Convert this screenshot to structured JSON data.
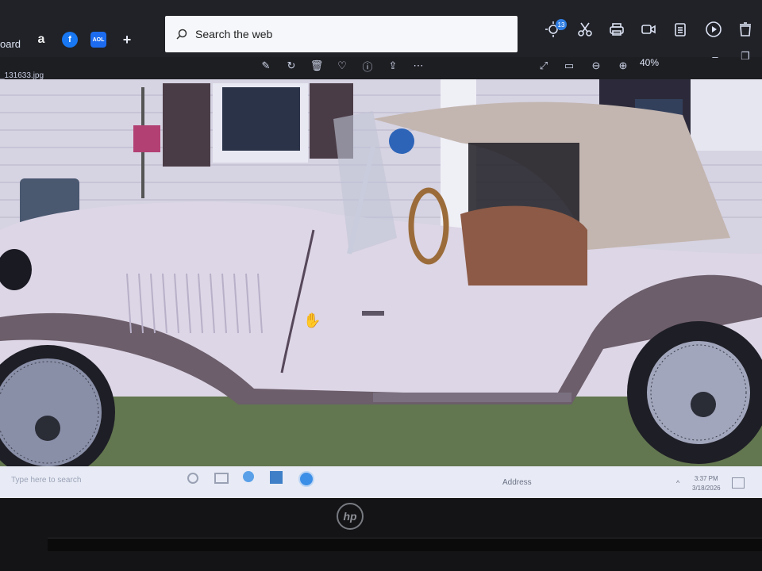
{
  "browser": {
    "tab_partial": "oard",
    "favorites": [
      {
        "label": "a",
        "icon": "amazon-icon",
        "color": "#f2f2f2"
      },
      {
        "label": "f",
        "icon": "facebook-icon",
        "color": "#1877f2"
      },
      {
        "label": "AOL",
        "icon": "aol-icon",
        "color": "#1d6cf0"
      }
    ],
    "add_label": "+",
    "search_placeholder": "Search the web",
    "notification_count": "13"
  },
  "viewer": {
    "filename": "_131633.jpg",
    "zoom": "40%",
    "toolbar_icons": [
      "edit-icon",
      "rotate-icon",
      "delete-icon",
      "favorite-icon",
      "info-icon",
      "share-icon",
      "more-icon"
    ],
    "right_icons": [
      "expand-icon",
      "fit-icon",
      "zoom-out-icon",
      "zoom-in-icon"
    ]
  },
  "taskbar": {
    "search_placeholder": "Type here to search",
    "address_label": "Address",
    "time": "3:37 PM",
    "date": "3/18/2026"
  },
  "laptop": {
    "brand": "hp"
  }
}
